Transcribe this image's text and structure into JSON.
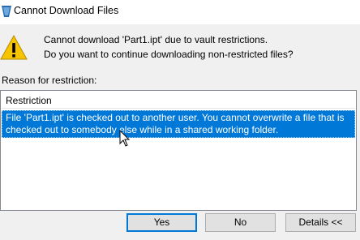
{
  "window": {
    "title": "Cannot Download Files",
    "icon": "vault-app-icon"
  },
  "message": {
    "icon": "warning-icon",
    "line1": "Cannot download 'Part1.ipt' due to vault restrictions.",
    "line2": "Do you want to continue downloading non-restricted files?"
  },
  "reason": {
    "label": "Reason for restriction:",
    "column_header": "Restriction",
    "rows": [
      "File 'Part1.ipt' is checked out to another user.  You cannot overwrite a file that is checked out to somebody else while in a shared working folder."
    ]
  },
  "buttons": {
    "yes": "Yes",
    "no": "No",
    "details": "Details <<"
  },
  "colors": {
    "selection": "#0078d7",
    "default_button_border": "#0078d7",
    "warning": "#f7c500"
  }
}
